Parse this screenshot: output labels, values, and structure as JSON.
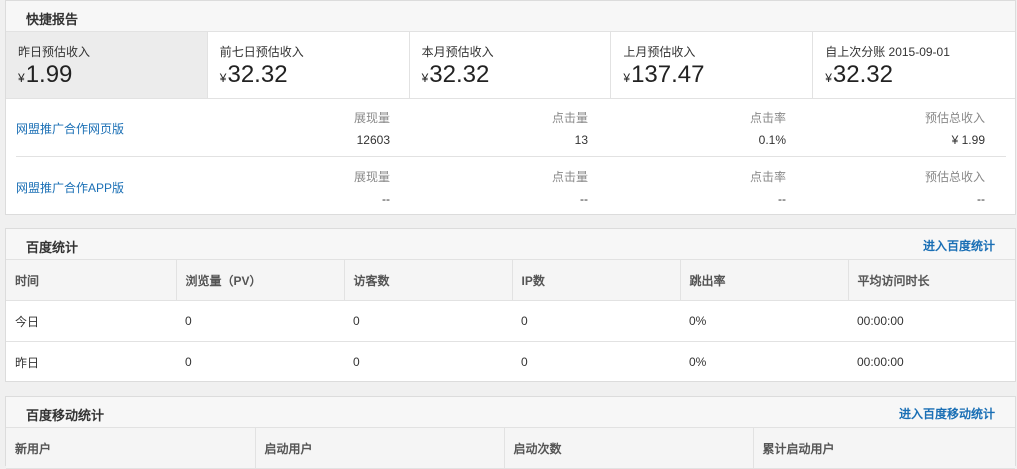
{
  "quick_report": {
    "title": "快捷报告",
    "stats": [
      {
        "label": "昨日预估收入",
        "currency": "¥",
        "value": "1.99"
      },
      {
        "label": "前七日预估收入",
        "currency": "¥",
        "value": "32.32"
      },
      {
        "label": "本月预估收入",
        "currency": "¥",
        "value": "32.32"
      },
      {
        "label": "上月预估收入",
        "currency": "¥",
        "value": "137.47"
      },
      {
        "label": "自上次分账 2015-09-01",
        "currency": "¥",
        "value": "32.32"
      }
    ],
    "products": [
      {
        "name": "网盟推广合作网页版",
        "impressions_label": "展现量",
        "impressions": "12603",
        "clicks_label": "点击量",
        "clicks": "13",
        "ctr_label": "点击率",
        "ctr": "0.1%",
        "revenue_label": "预估总收入",
        "revenue": "¥ 1.99"
      },
      {
        "name": "网盟推广合作APP版",
        "impressions_label": "展现量",
        "impressions": "--",
        "clicks_label": "点击量",
        "clicks": "--",
        "ctr_label": "点击率",
        "ctr": "--",
        "revenue_label": "预估总收入",
        "revenue": "--"
      }
    ]
  },
  "baidu_stats": {
    "title": "百度统计",
    "link": "进入百度统计",
    "columns": [
      "时间",
      "浏览量（PV）",
      "访客数",
      "IP数",
      "跳出率",
      "平均访问时长"
    ],
    "rows": [
      [
        "今日",
        "0",
        "0",
        "0",
        "0%",
        "00:00:00"
      ],
      [
        "昨日",
        "0",
        "0",
        "0",
        "0%",
        "00:00:00"
      ]
    ]
  },
  "baidu_mobile": {
    "title": "百度移动统计",
    "link": "进入百度移动统计",
    "columns": [
      "新用户",
      "启动用户",
      "启动次数",
      "累计启动用户"
    ]
  }
}
